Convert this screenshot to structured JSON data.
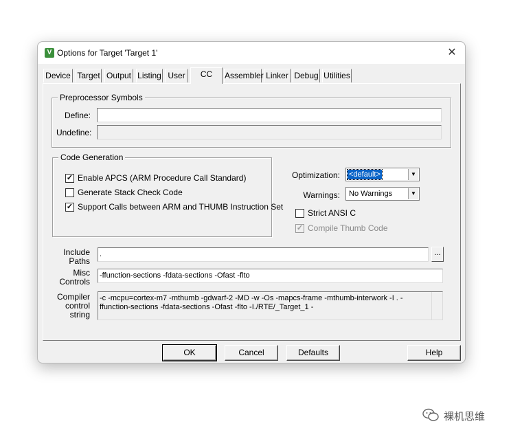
{
  "window": {
    "title": "Options for Target 'Target 1'",
    "icon": "keil-uvision-icon",
    "close_label": "✕"
  },
  "tabs": [
    {
      "label": "Device"
    },
    {
      "label": "Target"
    },
    {
      "label": "Output"
    },
    {
      "label": "Listing"
    },
    {
      "label": "User"
    },
    {
      "label": "C/C++",
      "shown_label": "CC",
      "active": true
    },
    {
      "label": "Assembler"
    },
    {
      "label": "Linker"
    },
    {
      "label": "Debug"
    },
    {
      "label": "Utilities"
    }
  ],
  "preprocessor": {
    "group_label": "Preprocessor Symbols",
    "define_label": "Define:",
    "define_value": "",
    "undefine_label": "Undefine:",
    "undefine_value": ""
  },
  "code_generation": {
    "group_label": "Code Generation",
    "options": [
      {
        "label": "Enable APCS (ARM Procedure Call Standard)",
        "checked": true
      },
      {
        "label": "Generate Stack Check Code",
        "checked": false
      },
      {
        "label": "Support Calls between ARM and THUMB Instruction Set",
        "checked": true
      }
    ]
  },
  "optimization": {
    "label": "Optimization:",
    "value": "<default>"
  },
  "warnings": {
    "label": "Warnings:",
    "value": "No Warnings"
  },
  "strict_ansi": {
    "label": "Strict ANSI C",
    "checked": false
  },
  "compile_thumb": {
    "label": "Compile Thumb Code",
    "checked": true,
    "disabled": true
  },
  "include_paths": {
    "label_line1": "Include",
    "label_line2": "Paths",
    "value": ".",
    "browse_label": "..."
  },
  "misc_controls": {
    "label_line1": "Misc",
    "label_line2": "Controls",
    "value": "-ffunction-sections -fdata-sections -Ofast -flto"
  },
  "compiler_control": {
    "label_line1": "Compiler",
    "label_line2": "control",
    "label_line3": "string",
    "value": "-c -mcpu=cortex-m7 -mthumb -gdwarf-2 -MD -w -Os -mapcs-frame -mthumb-interwork -I . -ffunction-sections -fdata-sections -Ofast -flto -I./RTE/_Target_1 -"
  },
  "buttons": {
    "ok": "OK",
    "cancel": "Cancel",
    "defaults": "Defaults",
    "help": "Help"
  },
  "watermark": {
    "text": "裸机思维"
  },
  "colors": {
    "dialog_bg": "#f0f0f0",
    "selection": "#0a64c8"
  }
}
